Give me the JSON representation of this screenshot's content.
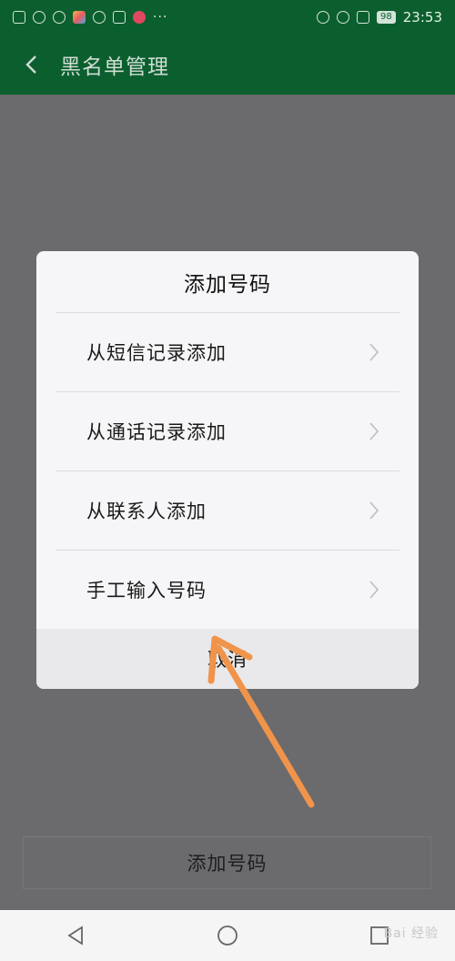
{
  "status_bar": {
    "time": "23:53",
    "battery": "98",
    "more": "···"
  },
  "header": {
    "title": "黑名单管理"
  },
  "dialog": {
    "title": "添加号码",
    "options": [
      {
        "label": "从短信记录添加"
      },
      {
        "label": "从通话记录添加"
      },
      {
        "label": "从联系人添加"
      },
      {
        "label": "手工输入号码"
      }
    ],
    "cancel_label": "取消"
  },
  "bottom_button": {
    "label": "添加号码"
  },
  "watermark": "Bai 经验",
  "colors": {
    "header_bg": "#0b5f2e",
    "overlay_bg": "#6b6a6d",
    "dialog_bg": "#f6f5f7",
    "annotation_arrow": "#f0944b"
  }
}
